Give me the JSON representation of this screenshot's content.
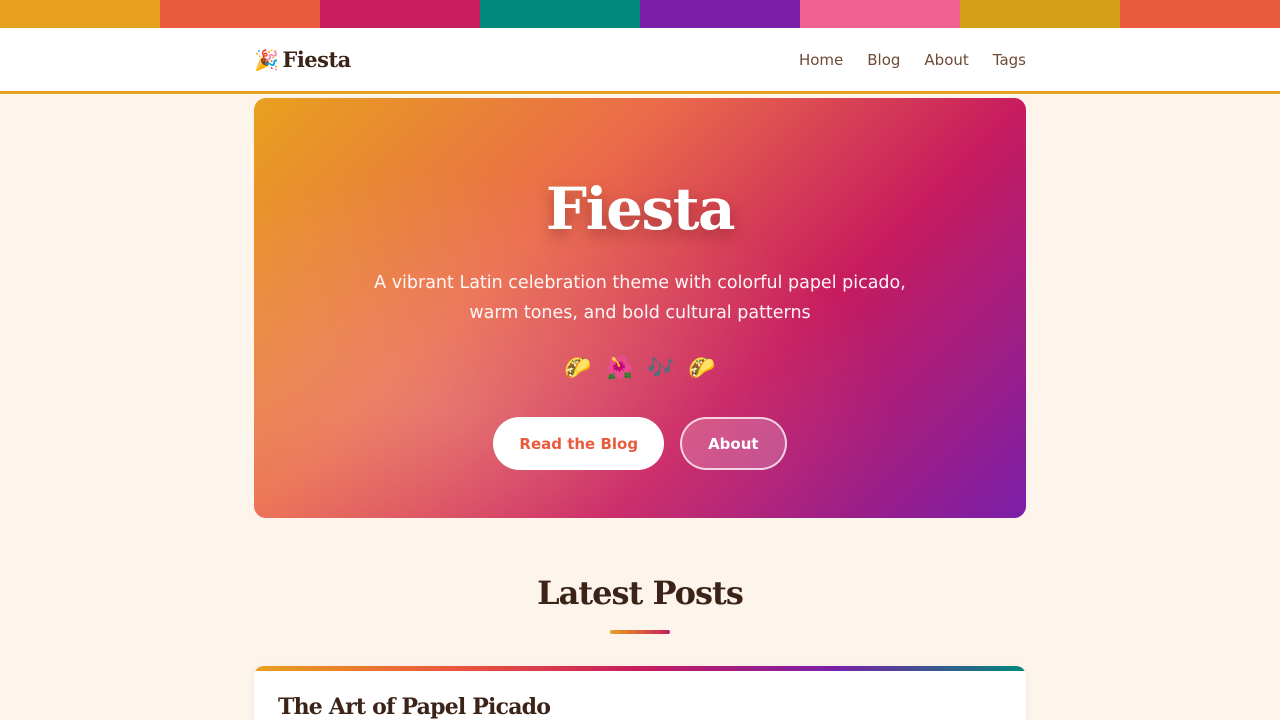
{
  "papel_picado_colors": [
    "#e8a11e",
    "#ea5a3c",
    "#c71c5e",
    "#00897b",
    "#7b1fa8",
    "#f06292",
    "#d4a017",
    "#ea5a3c"
  ],
  "header": {
    "logo_icon": "🎉",
    "logo_icon_name": "party-popper-icon",
    "logo_text": "Fiesta",
    "nav": [
      "Home",
      "Blog",
      "About",
      "Tags"
    ]
  },
  "hero": {
    "title": "Fiesta",
    "subtitle": "A vibrant Latin celebration theme with colorful papel picado, warm tones, and bold cultural patterns",
    "emojis": [
      "🌮",
      "🌺",
      "🎶",
      "🌮"
    ],
    "emoji_names": [
      "taco-icon",
      "hibiscus-icon",
      "music-notes-icon",
      "taco-icon"
    ],
    "primary_button": "Read the Blog",
    "secondary_button": "About"
  },
  "latest": {
    "title": "Latest Posts",
    "posts": [
      {
        "title": "The Art of Papel Picado"
      }
    ]
  }
}
